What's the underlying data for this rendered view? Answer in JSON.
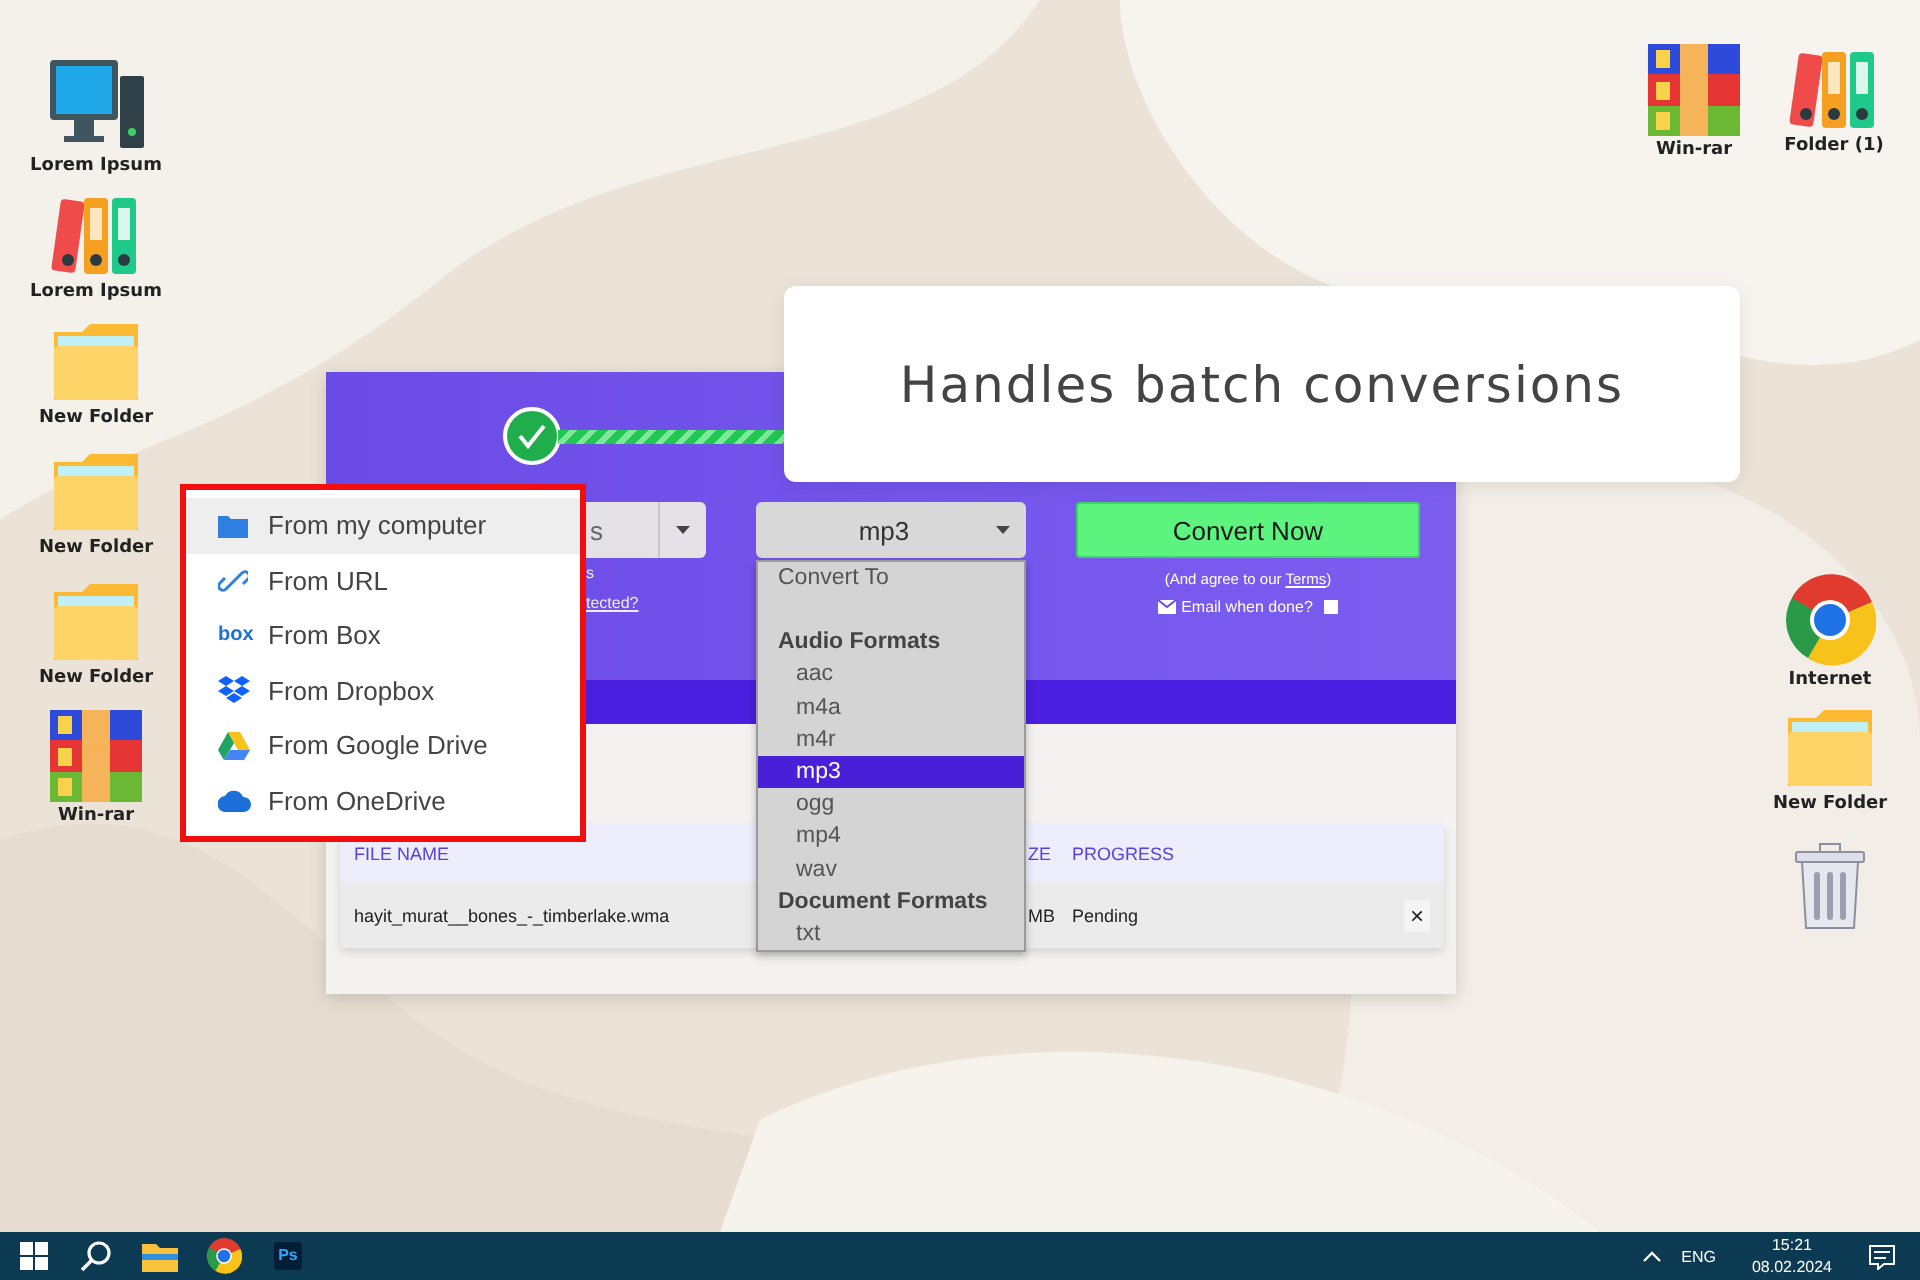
{
  "desktop_icons": [
    {
      "label": "Lorem Ipsum",
      "kind": "computer"
    },
    {
      "label": "Lorem Ipsum",
      "kind": "binders"
    },
    {
      "label": "New Folder",
      "kind": "folder"
    },
    {
      "label": "New Folder",
      "kind": "folder"
    },
    {
      "label": "New Folder",
      "kind": "folder"
    },
    {
      "label": "Win-rar",
      "kind": "archive"
    },
    {
      "label": "Win-rar",
      "kind": "archive"
    },
    {
      "label": "Folder (1)",
      "kind": "binders"
    },
    {
      "label": "Internet",
      "kind": "browser"
    },
    {
      "label": "New Folder",
      "kind": "folder"
    },
    {
      "kind": "trash"
    }
  ],
  "callout": {
    "text": "Handles batch conversions"
  },
  "converter": {
    "source_select": {
      "value": "s"
    },
    "notes": [
      {
        "text": "s",
        "kind": "plain"
      },
      {
        "text": "tected?",
        "kind": "link"
      }
    ],
    "format_select": {
      "value": "mp3"
    },
    "convert_button": "Convert Now",
    "terms": {
      "before": "(And agree to our ",
      "link": "Terms",
      "after": ")"
    },
    "email_option": {
      "label": "Email when done?",
      "checked": false
    },
    "table": {
      "columns": [
        "FILE NAME",
        "ZE",
        "PROGRESS"
      ],
      "rows": [
        {
          "file_name": "hayit_murat__bones_-_timberlake.wma",
          "size": "MB",
          "progress": "Pending",
          "remove": "×"
        }
      ]
    }
  },
  "format_menu": {
    "header": "Convert To",
    "groups": [
      {
        "title": "Audio Formats",
        "options": [
          {
            "label": "aac",
            "selected": false
          },
          {
            "label": "m4a",
            "selected": false
          },
          {
            "label": "m4r",
            "selected": false
          },
          {
            "label": "mp3",
            "selected": true
          },
          {
            "label": "ogg",
            "selected": false
          },
          {
            "label": "mp4",
            "selected": false
          },
          {
            "label": "wav",
            "selected": false
          }
        ]
      },
      {
        "title": "Document Formats",
        "options": [
          {
            "label": "txt",
            "selected": false
          }
        ]
      }
    ]
  },
  "source_menu": {
    "items": [
      {
        "label": "From my computer",
        "kind": "folder",
        "selected": true
      },
      {
        "label": "From URL",
        "kind": "link",
        "selected": false
      },
      {
        "label": "From Box",
        "kind": "wordmark",
        "icon_text": "box",
        "selected": false
      },
      {
        "label": "From Dropbox",
        "kind": "dropbox",
        "selected": false
      },
      {
        "label": "From Google Drive",
        "kind": "drive",
        "selected": false
      },
      {
        "label": "From OneDrive",
        "kind": "cloud",
        "selected": false
      }
    ]
  },
  "taskbar": {
    "apps": [
      {
        "kind": "start"
      },
      {
        "kind": "search"
      },
      {
        "kind": "files"
      },
      {
        "kind": "browser"
      },
      {
        "kind": "editor",
        "icon_text": "Ps"
      }
    ],
    "tray": {
      "language": "ENG",
      "time": "15:21",
      "date": "08.02.2024"
    }
  }
}
